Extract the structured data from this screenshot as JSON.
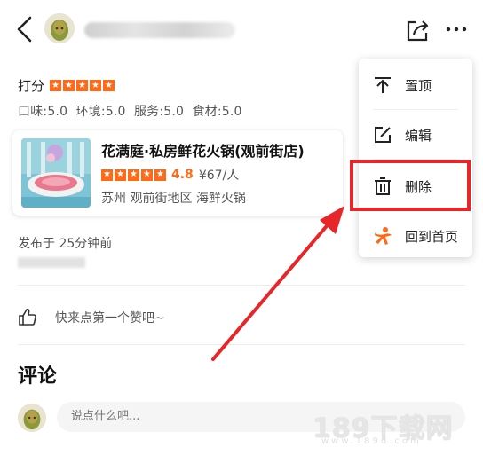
{
  "rating": {
    "label": "打分",
    "stars": 5
  },
  "sub_scores": "口味:5.0  环境:5.0  服务:5.0  食材:5.0",
  "shop": {
    "name": "花满庭·私房鲜花火锅(观前街店)",
    "stars": 5,
    "score": "4.8",
    "price": "¥67/人",
    "location": "苏州 观前街地区 海鲜火锅"
  },
  "posted": "发布于 25分钟前",
  "like_prompt": "快来点第一个赞吧~",
  "comments_title": "评论",
  "comment_input": {
    "placeholder": "说点什么吧..."
  },
  "menu": {
    "items": [
      {
        "label": "置顶",
        "icon": "pin-top-icon"
      },
      {
        "label": "编辑",
        "icon": "edit-icon"
      },
      {
        "label": "删除",
        "icon": "trash-icon"
      },
      {
        "label": "回到首页",
        "icon": "home-person-icon"
      }
    ]
  },
  "watermark": {
    "main": "189下载网",
    "sub": "www.189d.com"
  },
  "colors": {
    "accent": "#ff6a1a",
    "highlight": "#e8262a"
  }
}
